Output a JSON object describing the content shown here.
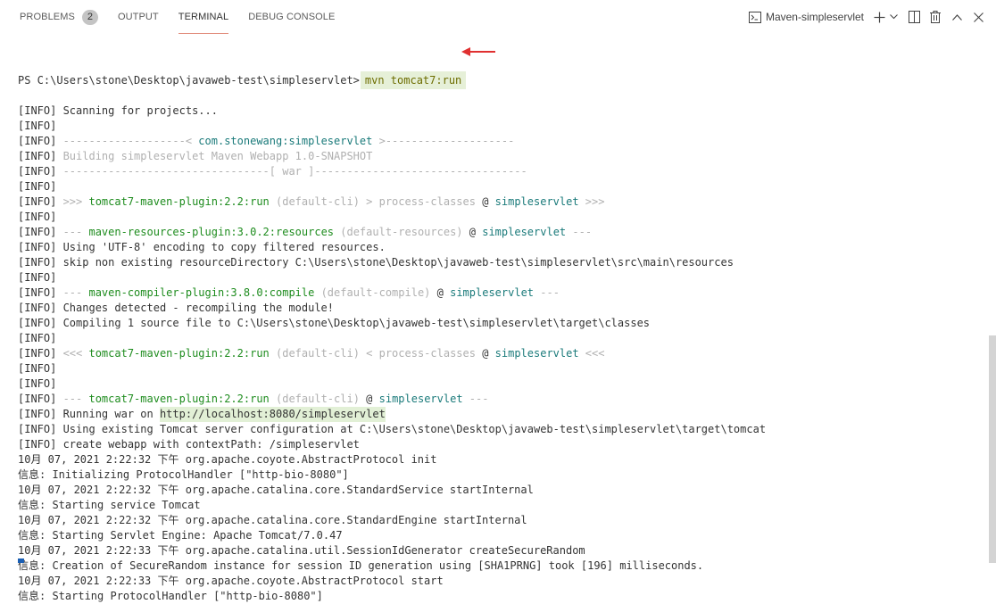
{
  "tabs": [
    {
      "label": "PROBLEMS",
      "badge": "2"
    },
    {
      "label": "OUTPUT"
    },
    {
      "label": "TERMINAL",
      "active": true
    },
    {
      "label": "DEBUG CONSOLE"
    }
  ],
  "terminal_selector": {
    "label": "Maven-simpleservlet"
  },
  "icons": [
    "terminal-icon",
    "plus-icon",
    "chevron-down-icon",
    "split-icon",
    "trash-icon",
    "chevron-up-icon",
    "close-icon"
  ],
  "prompt": {
    "path": "PS C:\\Users\\stone\\Desktop\\javaweb-test\\simpleservlet>",
    "command": "mvn tomcat7:run"
  },
  "lines": [
    [
      {
        "t": "[INFO] Scanning for projects..."
      }
    ],
    [
      {
        "t": "[INFO]"
      }
    ],
    [
      {
        "t": "[INFO] "
      },
      {
        "t": "-------------------< ",
        "c": "dim"
      },
      {
        "t": "com.stonewang:simpleservlet",
        "c": "teal"
      },
      {
        "t": " >--------------------",
        "c": "dim"
      }
    ],
    [
      {
        "t": "[INFO] "
      },
      {
        "t": "Building simpleservlet Maven Webapp 1.0-SNAPSHOT",
        "c": "dim"
      }
    ],
    [
      {
        "t": "[INFO] "
      },
      {
        "t": "--------------------------------[ war ]---------------------------------",
        "c": "dim"
      }
    ],
    [
      {
        "t": "[INFO]"
      }
    ],
    [
      {
        "t": "[INFO] "
      },
      {
        "t": ">>> ",
        "c": "dim"
      },
      {
        "t": "tomcat7-maven-plugin:2.2:run",
        "c": "green"
      },
      {
        "t": " (default-cli) > process-classes",
        "c": "dim"
      },
      {
        "t": " @ "
      },
      {
        "t": "simpleservlet",
        "c": "teal"
      },
      {
        "t": " >>>",
        "c": "dim"
      }
    ],
    [
      {
        "t": "[INFO]"
      }
    ],
    [
      {
        "t": "[INFO] "
      },
      {
        "t": "--- ",
        "c": "dim"
      },
      {
        "t": "maven-resources-plugin:3.0.2:resources",
        "c": "green"
      },
      {
        "t": " (default-resources)",
        "c": "dim"
      },
      {
        "t": " @ "
      },
      {
        "t": "simpleservlet",
        "c": "teal"
      },
      {
        "t": " ---",
        "c": "dim"
      }
    ],
    [
      {
        "t": "[INFO] Using 'UTF-8' encoding to copy filtered resources."
      }
    ],
    [
      {
        "t": "[INFO] skip non existing resourceDirectory C:\\Users\\stone\\Desktop\\javaweb-test\\simpleservlet\\src\\main\\resources"
      }
    ],
    [
      {
        "t": "[INFO]"
      }
    ],
    [
      {
        "t": "[INFO] "
      },
      {
        "t": "--- ",
        "c": "dim"
      },
      {
        "t": "maven-compiler-plugin:3.8.0:compile",
        "c": "green"
      },
      {
        "t": " (default-compile)",
        "c": "dim"
      },
      {
        "t": " @ "
      },
      {
        "t": "simpleservlet",
        "c": "teal"
      },
      {
        "t": " ---",
        "c": "dim"
      }
    ],
    [
      {
        "t": "[INFO] Changes detected - recompiling the module!"
      }
    ],
    [
      {
        "t": "[INFO] Compiling 1 source file to C:\\Users\\stone\\Desktop\\javaweb-test\\simpleservlet\\target\\classes"
      }
    ],
    [
      {
        "t": "[INFO]"
      }
    ],
    [
      {
        "t": "[INFO] "
      },
      {
        "t": "<<< ",
        "c": "dim"
      },
      {
        "t": "tomcat7-maven-plugin:2.2:run",
        "c": "green"
      },
      {
        "t": " (default-cli) < process-classes",
        "c": "dim"
      },
      {
        "t": " @ "
      },
      {
        "t": "simpleservlet",
        "c": "teal"
      },
      {
        "t": " <<<",
        "c": "dim"
      }
    ],
    [
      {
        "t": "[INFO]"
      }
    ],
    [
      {
        "t": "[INFO]"
      }
    ],
    [
      {
        "t": "[INFO] "
      },
      {
        "t": "--- ",
        "c": "dim"
      },
      {
        "t": "tomcat7-maven-plugin:2.2:run",
        "c": "green"
      },
      {
        "t": " (default-cli)",
        "c": "dim"
      },
      {
        "t": " @ "
      },
      {
        "t": "simpleservlet",
        "c": "teal"
      },
      {
        "t": " ---",
        "c": "dim"
      }
    ],
    [
      {
        "t": "[INFO] Running war on "
      },
      {
        "t": "http://localhost:8080/simpleservlet",
        "c": "hl"
      }
    ],
    [
      {
        "t": "[INFO] Using existing Tomcat server configuration at C:\\Users\\stone\\Desktop\\javaweb-test\\simpleservlet\\target\\tomcat"
      }
    ],
    [
      {
        "t": "[INFO] create webapp with contextPath: /simpleservlet"
      }
    ],
    [
      {
        "t": "10月 07, 2021 2:22:32 下午 org.apache.coyote.AbstractProtocol init"
      }
    ],
    [
      {
        "t": "信息: Initializing ProtocolHandler [\"http-bio-8080\"]"
      }
    ],
    [
      {
        "t": "10月 07, 2021 2:22:32 下午 org.apache.catalina.core.StandardService startInternal"
      }
    ],
    [
      {
        "t": "信息: Starting service Tomcat"
      }
    ],
    [
      {
        "t": "10月 07, 2021 2:22:32 下午 org.apache.catalina.core.StandardEngine startInternal"
      }
    ],
    [
      {
        "t": "信息: Starting Servlet Engine: Apache Tomcat/7.0.47"
      }
    ],
    [
      {
        "t": "10月 07, 2021 2:22:33 下午 org.apache.catalina.util.SessionIdGenerator createSecureRandom"
      }
    ],
    [
      {
        "t": "信息: Creation of SecureRandom instance for session ID generation using [SHA1PRNG] took [196] milliseconds."
      }
    ],
    [
      {
        "t": "10月 07, 2021 2:22:33 下午 org.apache.coyote.AbstractProtocol start"
      }
    ],
    [
      {
        "t": "信息: Starting ProtocolHandler [\"http-bio-8080\"]"
      }
    ]
  ]
}
